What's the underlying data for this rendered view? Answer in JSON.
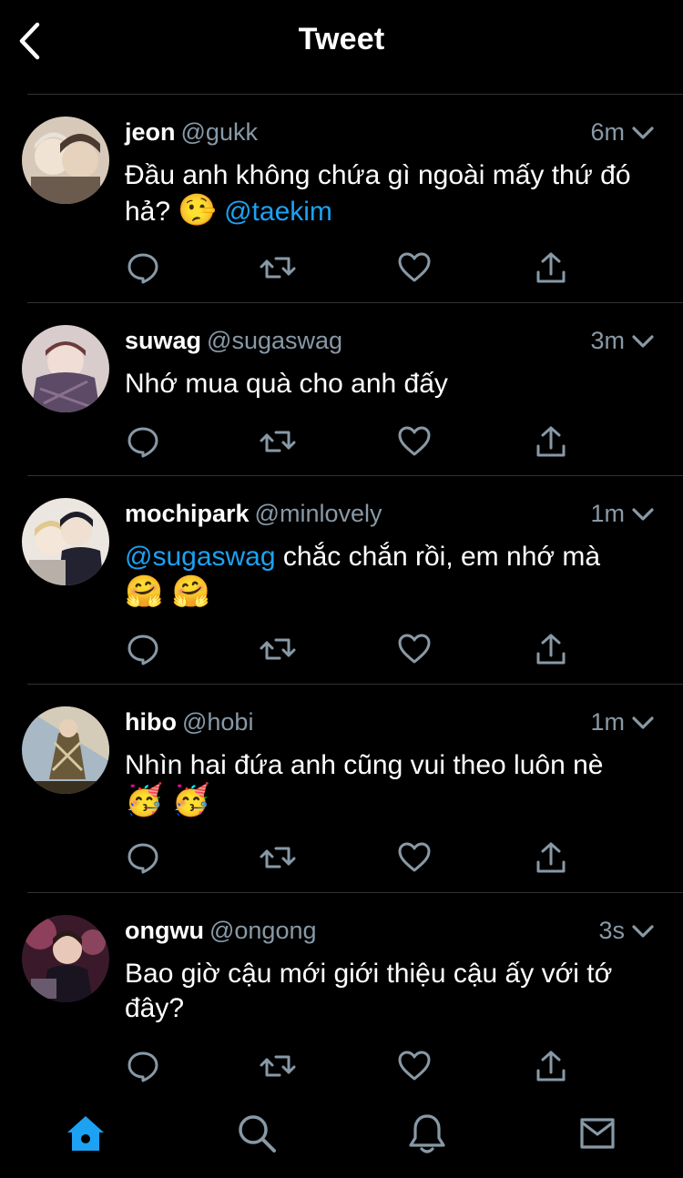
{
  "header": {
    "title": "Tweet"
  },
  "tweets": [
    {
      "name": "jeon",
      "handle": "@gukk",
      "time": "6m",
      "text": "Đầu anh không chứa gì ngoài mấy thứ đó hả?",
      "emoji": "🤥",
      "mention": "@taekim",
      "avatar_colors": [
        "#c8b8a8",
        "#6b5a4e",
        "#e9ddd0"
      ]
    },
    {
      "name": "suwag",
      "handle": "@sugaswag",
      "time": "3m",
      "text": "Nhớ mua quà cho anh đấy",
      "avatar_colors": [
        "#d8c8c8",
        "#5c4a66",
        "#8a7080"
      ]
    },
    {
      "name": "mochipark",
      "handle": "@minlovely",
      "time": "1m",
      "mention": "@sugaswag",
      "text": "chắc chắn rồi, em nhớ mà",
      "emoji": "🤗 🤗",
      "avatar_colors": [
        "#e8e0d8",
        "#222230",
        "#c9b89a"
      ]
    },
    {
      "name": "hibo",
      "handle": "@hobi",
      "time": "1m",
      "text": "Nhìn hai đứa anh cũng vui theo luôn nè",
      "emoji": "🥳 🥳",
      "avatar_colors": [
        "#9ab0c0",
        "#6a5a3a",
        "#d0c8b0"
      ]
    },
    {
      "name": "ongwu",
      "handle": "@ongong",
      "time": "3s",
      "text": "Bao giờ cậu mới giới thiệu cậu ấy với tớ đây?",
      "avatar_colors": [
        "#5a2a3a",
        "#b05070",
        "#2a1a2a"
      ]
    }
  ],
  "tabbar": {
    "icons": [
      "home-icon",
      "search-icon",
      "bell-icon",
      "mail-icon"
    ],
    "active_color": "#1da1f2",
    "inactive_color": "#8899a6"
  }
}
